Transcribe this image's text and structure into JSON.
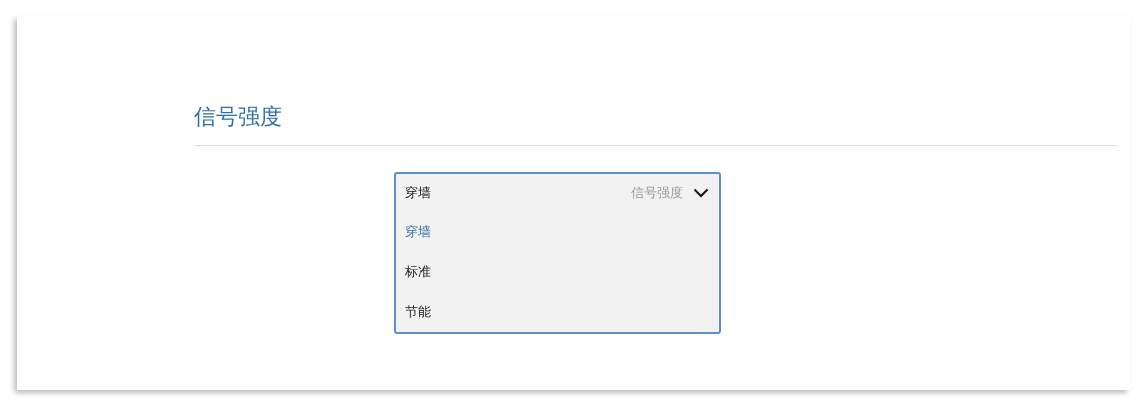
{
  "section": {
    "title": "信号强度"
  },
  "dropdown": {
    "value": "穿墙",
    "label": "信号强度",
    "expanded": true,
    "options": [
      {
        "label": "穿墙",
        "selected": true
      },
      {
        "label": "标准",
        "selected": false
      },
      {
        "label": "节能",
        "selected": false
      }
    ]
  }
}
